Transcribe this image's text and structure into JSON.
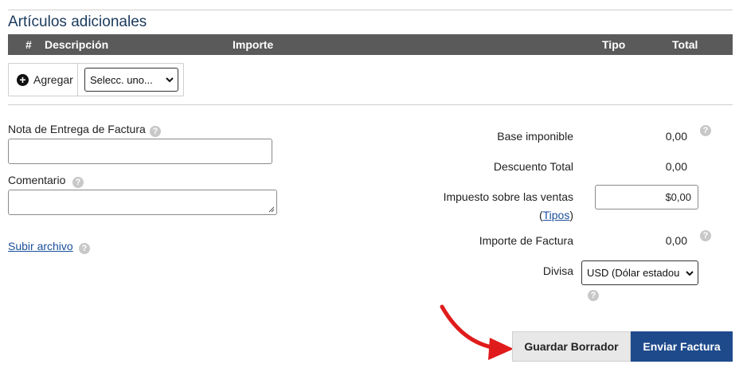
{
  "section": {
    "title": "Artículos adicionales"
  },
  "table": {
    "columns": [
      "#",
      "Descripción",
      "Importe",
      "Tipo",
      "Total"
    ]
  },
  "add_items": {
    "button_label": "Agregar",
    "type_select_value": "Selecc. uno..."
  },
  "form": {
    "delivery_note_label": "Nota de Entrega de Factura",
    "delivery_note_value": "",
    "comment_label": "Comentario",
    "comment_value": "",
    "upload_link": "Subir archivo"
  },
  "summary": {
    "base_label": "Base imponible",
    "base_value": "0,00",
    "discount_label": "Descuento Total",
    "discount_value": "0,00",
    "tax_label": "Impuesto sobre las ventas",
    "tax_types_open": "(",
    "tax_types_link": "Tipos",
    "tax_types_close": ")",
    "tax_value": "$0,00",
    "invoice_label": "Importe de Factura",
    "invoice_value": "0,00",
    "currency_label": "Divisa",
    "currency_value": "USD (Dólar estadou"
  },
  "actions": {
    "save_draft": "Guardar Borrador",
    "send_invoice": "Enviar Factura"
  },
  "colors": {
    "header_bg": "#5a5a5a",
    "primary": "#1e4a8c",
    "link": "#1a4f9c",
    "arrow": "#e01b1b"
  }
}
